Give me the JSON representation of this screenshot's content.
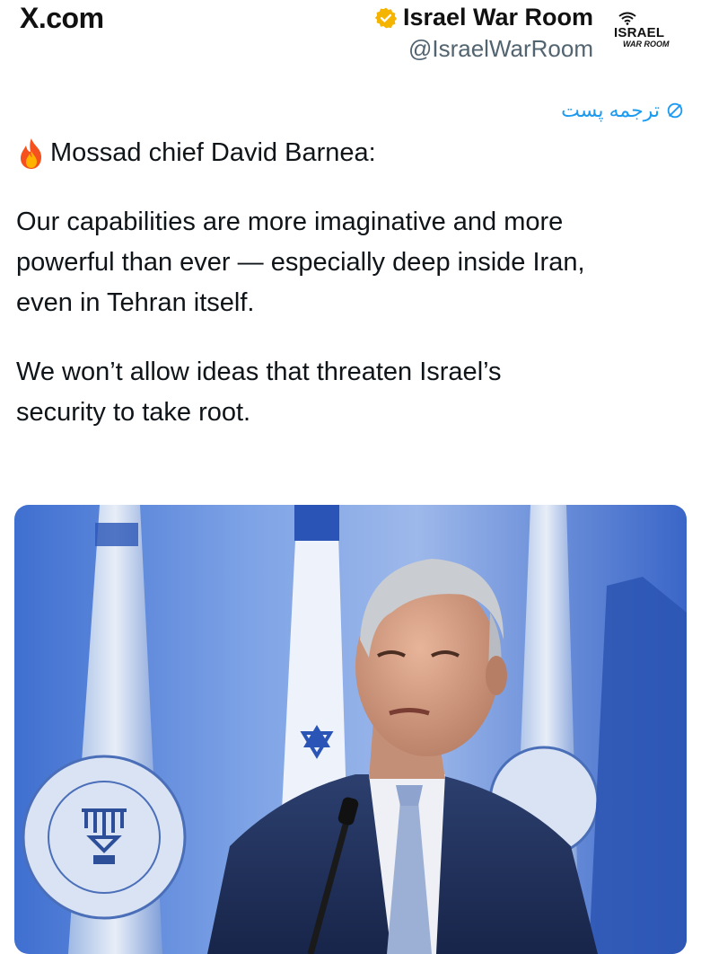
{
  "header": {
    "brand": "X.com",
    "author_name": "Israel War Room",
    "author_handle": "@IsraelWarRoom",
    "logo_line1": "ISRAEL",
    "logo_line2": "WAR ROOM",
    "verified_icon": "verified-badge-icon",
    "verified_color": "#f4b400"
  },
  "translate": {
    "label": "ترجمه پست",
    "icon": "translate-icon",
    "color": "#1d9bf0"
  },
  "post": {
    "line1_emoji": "fire-icon",
    "line1": "Mossad chief David Barnea:",
    "para1": [
      "Our capabilities are more imaginative and more",
      "powerful than ever — especially deep inside Iran,",
      "even in Tehran itself."
    ],
    "para2": [
      "We won’t allow ideas that threaten Israel’s",
      "security to take root."
    ]
  },
  "media": {
    "kind": "photo",
    "description_icon": "speaker-photo"
  }
}
